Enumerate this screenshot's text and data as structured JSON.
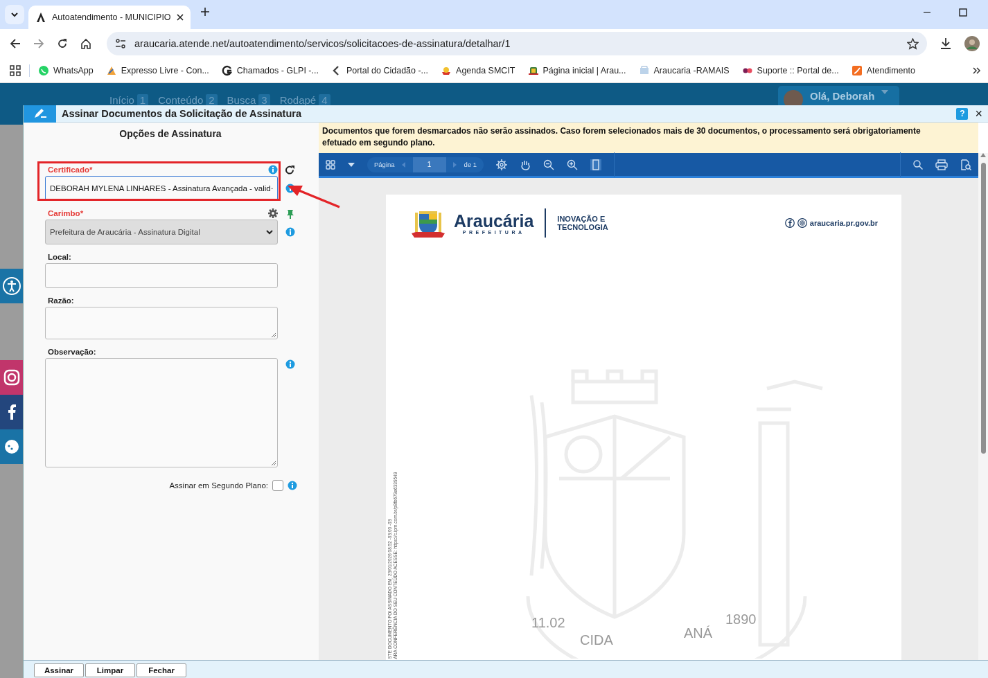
{
  "browser": {
    "tab": {
      "title": "Autoatendimento - MUNICIPIO"
    },
    "address": "araucaria.atende.net/autoatendimento/servicos/solicitacoes-de-assinatura/detalhar/1",
    "bookmarks": [
      {
        "label": "WhatsApp"
      },
      {
        "label": "Expresso Livre - Con..."
      },
      {
        "label": "Chamados - GLPI -..."
      },
      {
        "label": "Portal do Cidadão -..."
      },
      {
        "label": "Agenda SMCIT"
      },
      {
        "label": "Página inicial | Arau..."
      },
      {
        "label": "Araucaria -RAMAIS"
      },
      {
        "label": "Suporte :: Portal de..."
      },
      {
        "label": "Atendimento"
      }
    ]
  },
  "site": {
    "nav": [
      {
        "label": "Início",
        "key": "1"
      },
      {
        "label": "Conteúdo",
        "key": "2"
      },
      {
        "label": "Busca",
        "key": "3"
      },
      {
        "label": "Rodapé",
        "key": "4"
      }
    ],
    "greeting": "Olá, Deborah"
  },
  "dialog": {
    "title": "Assinar Documentos da Solicitação de Assinatura",
    "help": "?",
    "close": "×",
    "form": {
      "heading": "Opções de Assinatura",
      "fields": [
        {
          "kind": "select",
          "label": "Certificado*",
          "required": true,
          "value": "DEBORAH MYLENA LINHARES - Assinatura Avançada - valid",
          "disabled": false,
          "highlighted": true
        },
        {
          "kind": "select",
          "label": "Carimbo*",
          "required": true,
          "value": "Prefeitura de Araucária - Assinatura Digital",
          "disabled": true,
          "highlighted": false
        },
        {
          "kind": "input",
          "label": "Local:",
          "required": false
        },
        {
          "kind": "textarea",
          "label": "Razão:",
          "required": false
        },
        {
          "kind": "textarea",
          "label": "Observação:",
          "required": false,
          "tall": true
        }
      ],
      "background_option": {
        "label": "Assinar em Segundo Plano:",
        "checked": false
      }
    },
    "notice": "Documentos que forem desmarcados não serão assinados. Caso forem selecionados mais de 30 documentos, o processamento será obrigatoriamente efetuado em segundo plano.",
    "viewer": {
      "page_label": "Página",
      "page": "1",
      "page_total": "de 1",
      "document": {
        "brand": "Araucária",
        "brand_sub": "PREFEITURA",
        "department": "INOVAÇÃO E TECNOLOGIA",
        "website": "araucaria.pr.gov.br",
        "stamp_lines": [
          "STE DOCUMENTO FOI ASSINADO EM: 23/01/2026 08:52 -03:00 -03",
          "ARA CONFERÊNCIA DO SEU CONTEÚDO ACESSE: https://c.ipm.com.br/p8fb679a6339549"
        ],
        "emblem_texts": [
          "11.02",
          "CIDA",
          "ANÁ",
          "1890"
        ]
      }
    },
    "buttons": [
      "Assinar",
      "Limpar",
      "Fechar"
    ]
  }
}
